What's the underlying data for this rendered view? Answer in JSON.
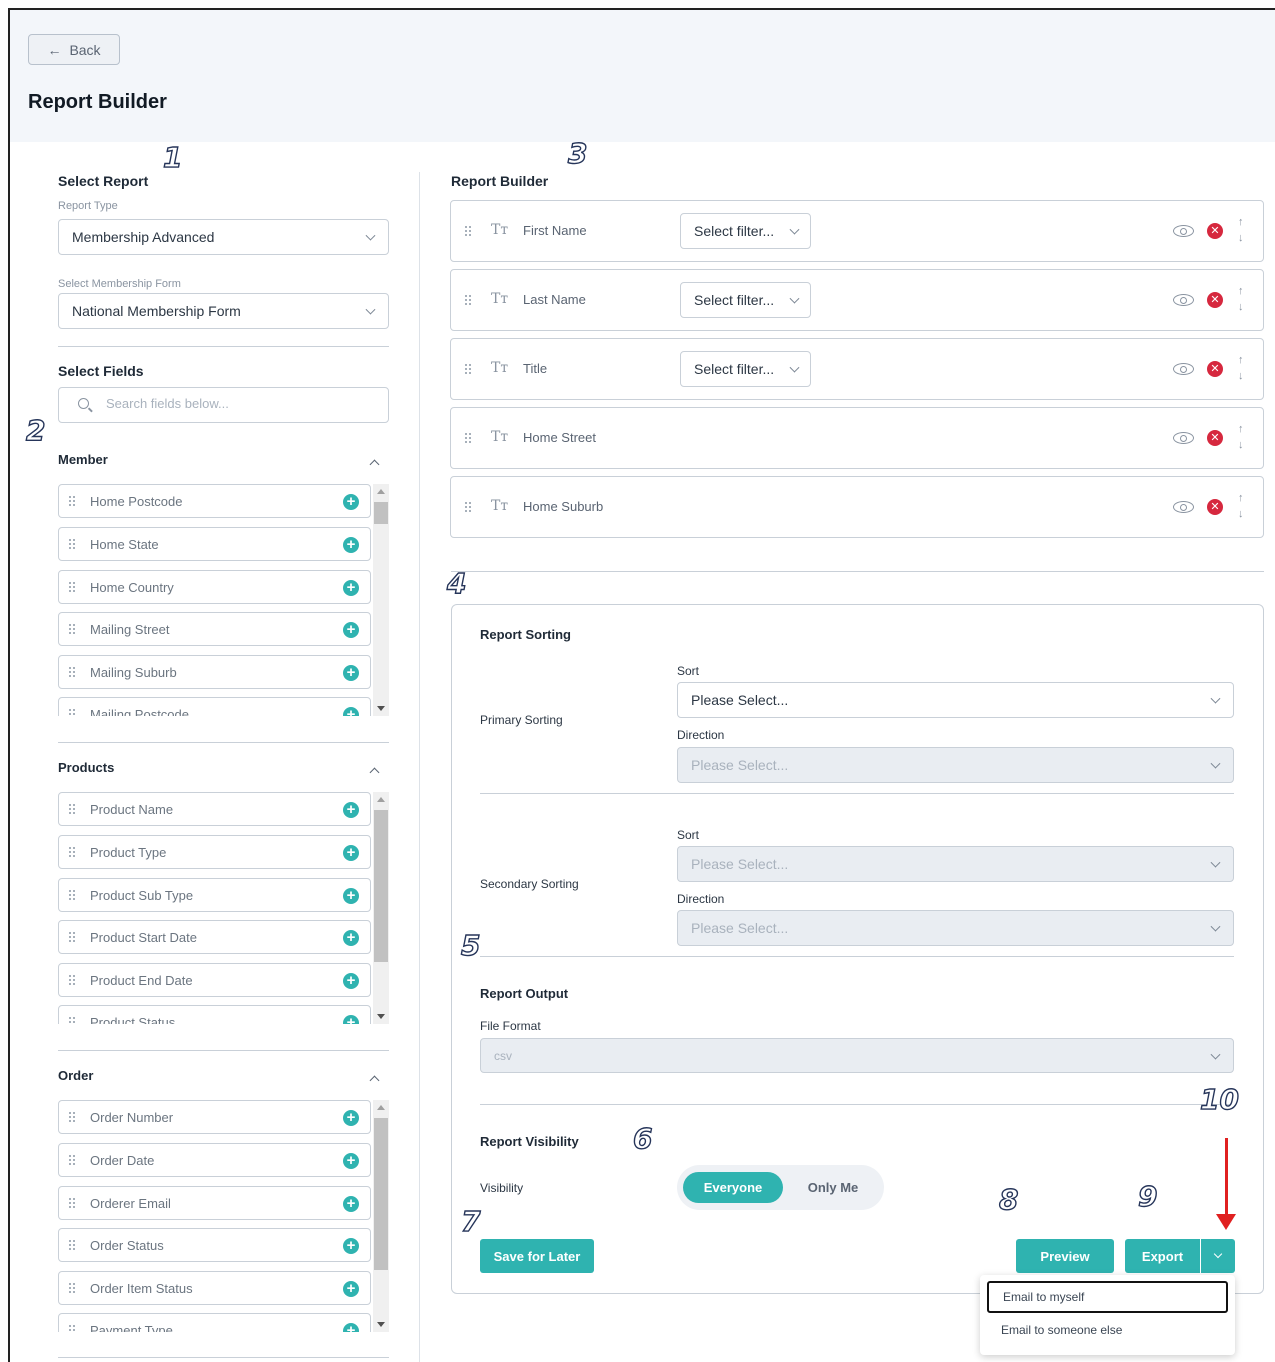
{
  "header": {
    "back_label": "Back",
    "page_title": "Report Builder"
  },
  "select_report": {
    "title": "Select Report",
    "report_type_label": "Report Type",
    "report_type_value": "Membership Advanced",
    "membership_form_label": "Select Membership Form",
    "membership_form_value": "National Membership Form"
  },
  "select_fields": {
    "title": "Select Fields",
    "search_placeholder": "Search fields below...",
    "groups": [
      {
        "title": "Member",
        "items": [
          "Home Postcode",
          "Home State",
          "Home Country",
          "Mailing Street",
          "Mailing Suburb",
          "Mailing Postcode"
        ]
      },
      {
        "title": "Products",
        "items": [
          "Product Name",
          "Product Type",
          "Product Sub Type",
          "Product Start Date",
          "Product End Date",
          "Product Status"
        ]
      },
      {
        "title": "Order",
        "items": [
          "Order Number",
          "Order Date",
          "Orderer Email",
          "Order Status",
          "Order Item Status",
          "Payment Type"
        ]
      }
    ]
  },
  "builder": {
    "title": "Report Builder",
    "type_icon_text": "Tт",
    "filter_placeholder": "Select filter...",
    "rows": [
      {
        "name": "First Name",
        "has_filter": true
      },
      {
        "name": "Last Name",
        "has_filter": true
      },
      {
        "name": "Title",
        "has_filter": true
      },
      {
        "name": "Home Street",
        "has_filter": false
      },
      {
        "name": "Home Suburb",
        "has_filter": false
      }
    ]
  },
  "sorting": {
    "title": "Report Sorting",
    "primary_label": "Primary Sorting",
    "secondary_label": "Secondary Sorting",
    "sort_label": "Sort",
    "direction_label": "Direction",
    "primary_sort_value": "Please Select...",
    "primary_direction_value": "Please Select...",
    "secondary_sort_value": "Please Select...",
    "secondary_direction_value": "Please Select..."
  },
  "output": {
    "title": "Report Output",
    "file_format_label": "File Format",
    "file_format_value": "csv"
  },
  "visibility": {
    "title": "Report Visibility",
    "label": "Visibility",
    "option_everyone": "Everyone",
    "option_only_me": "Only Me",
    "selected": "Everyone"
  },
  "actions": {
    "save_label": "Save for Later",
    "preview_label": "Preview",
    "export_label": "Export"
  },
  "export_menu": {
    "items": [
      "Email to myself",
      "Email to someone else"
    ]
  },
  "markers": [
    "1",
    "2",
    "3",
    "4",
    "5",
    "6",
    "7",
    "8",
    "9",
    "10"
  ],
  "colors": {
    "accent": "#2fb3b0",
    "danger": "#d6283e",
    "annotation_arrow": "#e02020"
  }
}
